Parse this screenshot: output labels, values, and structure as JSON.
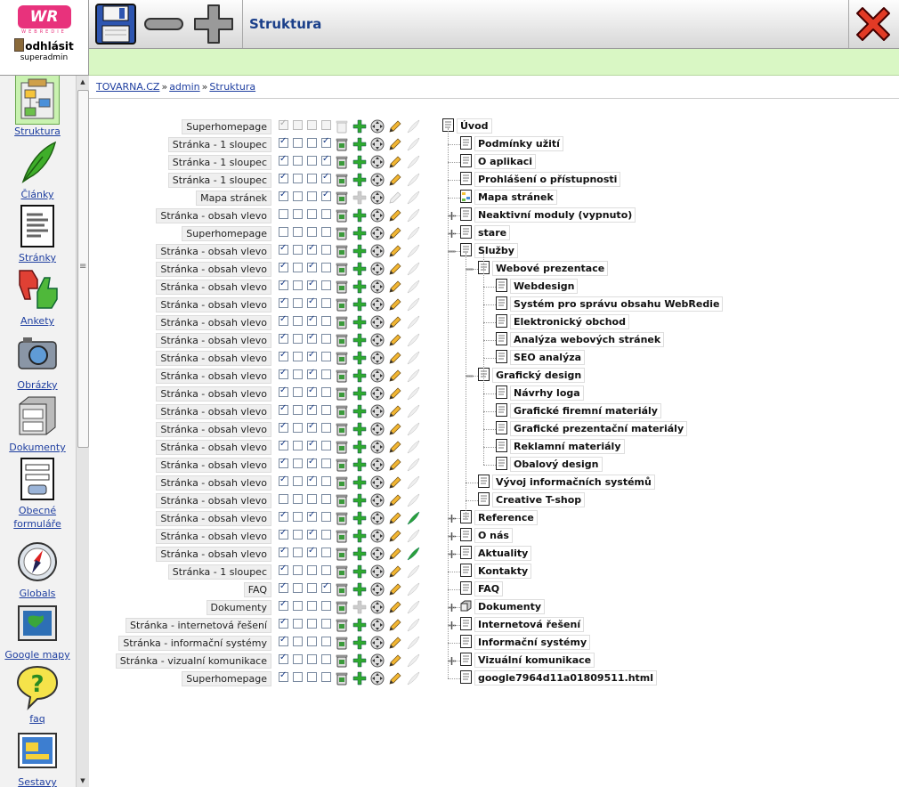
{
  "app": {
    "logo_text": "WR",
    "logo_sub": "WEBREDIE",
    "logout_label": "odhlásit",
    "user": "superadmin",
    "page_title": "Struktura"
  },
  "breadcrumb": [
    "TOVARNA.CZ",
    "admin",
    "Struktura"
  ],
  "nav": [
    {
      "id": "struktura",
      "label": "Struktura",
      "icon": "structure-icon",
      "active": true
    },
    {
      "id": "clanky",
      "label": "Články",
      "icon": "feather-icon"
    },
    {
      "id": "stranky",
      "label": "Stránky",
      "icon": "page-icon"
    },
    {
      "id": "ankety",
      "label": "Ankety",
      "icon": "thumbs-icon"
    },
    {
      "id": "obrazky",
      "label": "Obrázky",
      "icon": "camera-icon"
    },
    {
      "id": "dokumenty",
      "label": "Dokumenty",
      "icon": "file-cabinet-icon"
    },
    {
      "id": "formulare",
      "label": "Obecné formuláře",
      "icon": "form-icon"
    },
    {
      "id": "globals",
      "label": "Globals",
      "icon": "compass-icon"
    },
    {
      "id": "google",
      "label": "Google mapy",
      "icon": "map-icon"
    },
    {
      "id": "faq",
      "label": "faq",
      "icon": "question-icon"
    },
    {
      "id": "sestavy",
      "label": "Sestavy",
      "icon": "window-icon"
    }
  ],
  "rows": [
    {
      "tpl": "Superhomepage",
      "cb": [
        1,
        0,
        0,
        0
      ],
      "dis": true,
      "add": 1,
      "move": 1,
      "feather": 0,
      "name": "Úvod",
      "depth": 0,
      "exp": "",
      "icon": "page"
    },
    {
      "tpl": "Stránka - 1 sloupec",
      "cb": [
        1,
        0,
        0,
        1
      ],
      "add": 1,
      "move": 1,
      "feather": 0,
      "name": "Podmínky užití",
      "depth": 1,
      "exp": "",
      "icon": "page"
    },
    {
      "tpl": "Stránka - 1 sloupec",
      "cb": [
        1,
        0,
        0,
        1
      ],
      "add": 1,
      "move": 1,
      "feather": 0,
      "name": "O aplikaci",
      "depth": 1,
      "exp": "",
      "icon": "page"
    },
    {
      "tpl": "Stránka - 1 sloupec",
      "cb": [
        1,
        0,
        0,
        1
      ],
      "add": 1,
      "move": 1,
      "feather": 0,
      "name": "Prohlášení o přístupnosti",
      "depth": 1,
      "exp": "",
      "icon": "page"
    },
    {
      "tpl": "Mapa stránek",
      "cb": [
        1,
        0,
        0,
        1
      ],
      "add": 0,
      "move": 1,
      "feather": 0,
      "pencilOff": 1,
      "name": "Mapa stránek",
      "depth": 1,
      "exp": "",
      "icon": "sitemap"
    },
    {
      "tpl": "Stránka - obsah vlevo",
      "cb": [
        0,
        0,
        0,
        0
      ],
      "add": 1,
      "move": 1,
      "feather": 0,
      "name": "Neaktivní moduly (vypnuto)",
      "depth": 1,
      "exp": "plus",
      "icon": "page"
    },
    {
      "tpl": "Superhomepage",
      "cb": [
        0,
        0,
        0,
        0
      ],
      "add": 1,
      "move": 1,
      "feather": 0,
      "name": "stare",
      "depth": 1,
      "exp": "plus",
      "icon": "page"
    },
    {
      "tpl": "Stránka - obsah vlevo",
      "cb": [
        1,
        0,
        1,
        0
      ],
      "add": 1,
      "move": 1,
      "feather": 0,
      "name": "Služby",
      "depth": 1,
      "exp": "minus",
      "icon": "page"
    },
    {
      "tpl": "Stránka - obsah vlevo",
      "cb": [
        1,
        0,
        1,
        0
      ],
      "add": 1,
      "move": 1,
      "feather": 0,
      "name": "Webové prezentace",
      "depth": 2,
      "exp": "minus",
      "icon": "page"
    },
    {
      "tpl": "Stránka - obsah vlevo",
      "cb": [
        1,
        0,
        1,
        0
      ],
      "add": 1,
      "move": 1,
      "feather": 0,
      "name": "Webdesign",
      "depth": 3,
      "exp": "",
      "icon": "page"
    },
    {
      "tpl": "Stránka - obsah vlevo",
      "cb": [
        1,
        0,
        1,
        0
      ],
      "add": 1,
      "move": 1,
      "feather": 0,
      "name": "Systém pro správu obsahu WebRedie",
      "depth": 3,
      "exp": "",
      "icon": "page"
    },
    {
      "tpl": "Stránka - obsah vlevo",
      "cb": [
        1,
        0,
        1,
        0
      ],
      "add": 1,
      "move": 1,
      "feather": 0,
      "name": "Elektronický obchod",
      "depth": 3,
      "exp": "",
      "icon": "page"
    },
    {
      "tpl": "Stránka - obsah vlevo",
      "cb": [
        1,
        0,
        1,
        0
      ],
      "add": 1,
      "move": 1,
      "feather": 0,
      "name": "Analýza webových stránek",
      "depth": 3,
      "exp": "",
      "icon": "page"
    },
    {
      "tpl": "Stránka - obsah vlevo",
      "cb": [
        1,
        0,
        1,
        0
      ],
      "add": 1,
      "move": 1,
      "feather": 0,
      "name": "SEO analýza",
      "depth": 3,
      "exp": "",
      "icon": "page"
    },
    {
      "tpl": "Stránka - obsah vlevo",
      "cb": [
        1,
        0,
        1,
        0
      ],
      "add": 1,
      "move": 1,
      "feather": 0,
      "name": "Grafický design",
      "depth": 2,
      "exp": "minus",
      "icon": "page"
    },
    {
      "tpl": "Stránka - obsah vlevo",
      "cb": [
        1,
        0,
        1,
        0
      ],
      "add": 1,
      "move": 1,
      "feather": 0,
      "name": "Návrhy loga",
      "depth": 3,
      "exp": "",
      "icon": "page"
    },
    {
      "tpl": "Stránka - obsah vlevo",
      "cb": [
        1,
        0,
        1,
        0
      ],
      "add": 1,
      "move": 1,
      "feather": 0,
      "name": "Grafické firemní materiály",
      "depth": 3,
      "exp": "",
      "icon": "page"
    },
    {
      "tpl": "Stránka - obsah vlevo",
      "cb": [
        1,
        0,
        1,
        0
      ],
      "add": 1,
      "move": 1,
      "feather": 0,
      "name": "Grafické prezentační materiály",
      "depth": 3,
      "exp": "",
      "icon": "page"
    },
    {
      "tpl": "Stránka - obsah vlevo",
      "cb": [
        1,
        0,
        1,
        0
      ],
      "add": 1,
      "move": 1,
      "feather": 0,
      "name": "Reklamní materiály",
      "depth": 3,
      "exp": "",
      "icon": "page"
    },
    {
      "tpl": "Stránka - obsah vlevo",
      "cb": [
        1,
        0,
        1,
        0
      ],
      "add": 1,
      "move": 1,
      "feather": 0,
      "name": "Obalový design",
      "depth": 3,
      "exp": "",
      "icon": "page"
    },
    {
      "tpl": "Stránka - obsah vlevo",
      "cb": [
        1,
        0,
        1,
        0
      ],
      "add": 1,
      "move": 1,
      "feather": 0,
      "name": "Vývoj informačních systémů",
      "depth": 2,
      "exp": "",
      "icon": "page"
    },
    {
      "tpl": "Stránka - obsah vlevo",
      "cb": [
        0,
        0,
        0,
        0
      ],
      "add": 1,
      "move": 1,
      "feather": 0,
      "name": "Creative T-shop",
      "depth": 2,
      "exp": "",
      "icon": "page"
    },
    {
      "tpl": "Stránka - obsah vlevo",
      "cb": [
        1,
        0,
        1,
        0
      ],
      "add": 1,
      "move": 1,
      "feather": 1,
      "name": "Reference",
      "depth": 1,
      "exp": "plus",
      "icon": "page"
    },
    {
      "tpl": "Stránka - obsah vlevo",
      "cb": [
        1,
        0,
        1,
        0
      ],
      "add": 1,
      "move": 1,
      "feather": 0,
      "name": "O nás",
      "depth": 1,
      "exp": "plus",
      "icon": "page"
    },
    {
      "tpl": "Stránka - obsah vlevo",
      "cb": [
        1,
        0,
        1,
        0
      ],
      "add": 1,
      "move": 1,
      "feather": 1,
      "name": "Aktuality",
      "depth": 1,
      "exp": "plus",
      "icon": "page"
    },
    {
      "tpl": "Stránka - 1 sloupec",
      "cb": [
        1,
        0,
        0,
        0
      ],
      "add": 1,
      "move": 1,
      "feather": 0,
      "name": "Kontakty",
      "depth": 1,
      "exp": "",
      "icon": "page"
    },
    {
      "tpl": "FAQ",
      "cb": [
        1,
        0,
        0,
        1
      ],
      "add": 1,
      "move": 1,
      "feather": 0,
      "name": "FAQ",
      "depth": 1,
      "exp": "",
      "icon": "page"
    },
    {
      "tpl": "Dokumenty",
      "cb": [
        1,
        0,
        0,
        0
      ],
      "add": 0,
      "move": 1,
      "feather": 0,
      "name": "Dokumenty",
      "depth": 1,
      "exp": "plus",
      "icon": "docs"
    },
    {
      "tpl": "Stránka - internetová řešení",
      "cb": [
        1,
        0,
        0,
        0
      ],
      "add": 1,
      "move": 1,
      "feather": 0,
      "name": "Internetová řešení",
      "depth": 1,
      "exp": "plus",
      "icon": "page"
    },
    {
      "tpl": "Stránka - informační systémy",
      "cb": [
        1,
        0,
        0,
        0
      ],
      "add": 1,
      "move": 1,
      "feather": 0,
      "name": "Informační systémy",
      "depth": 1,
      "exp": "",
      "icon": "page"
    },
    {
      "tpl": "Stránka - vizualní komunikace",
      "cb": [
        1,
        0,
        0,
        0
      ],
      "add": 1,
      "move": 1,
      "feather": 0,
      "name": "Vizuální komunikace",
      "depth": 1,
      "exp": "plus",
      "icon": "page"
    },
    {
      "tpl": "Superhomepage",
      "cb": [
        1,
        0,
        0,
        0
      ],
      "add": 1,
      "move": 1,
      "feather": 0,
      "name": "google7964d11a01809511.html",
      "depth": 1,
      "exp": "",
      "icon": "page"
    }
  ]
}
